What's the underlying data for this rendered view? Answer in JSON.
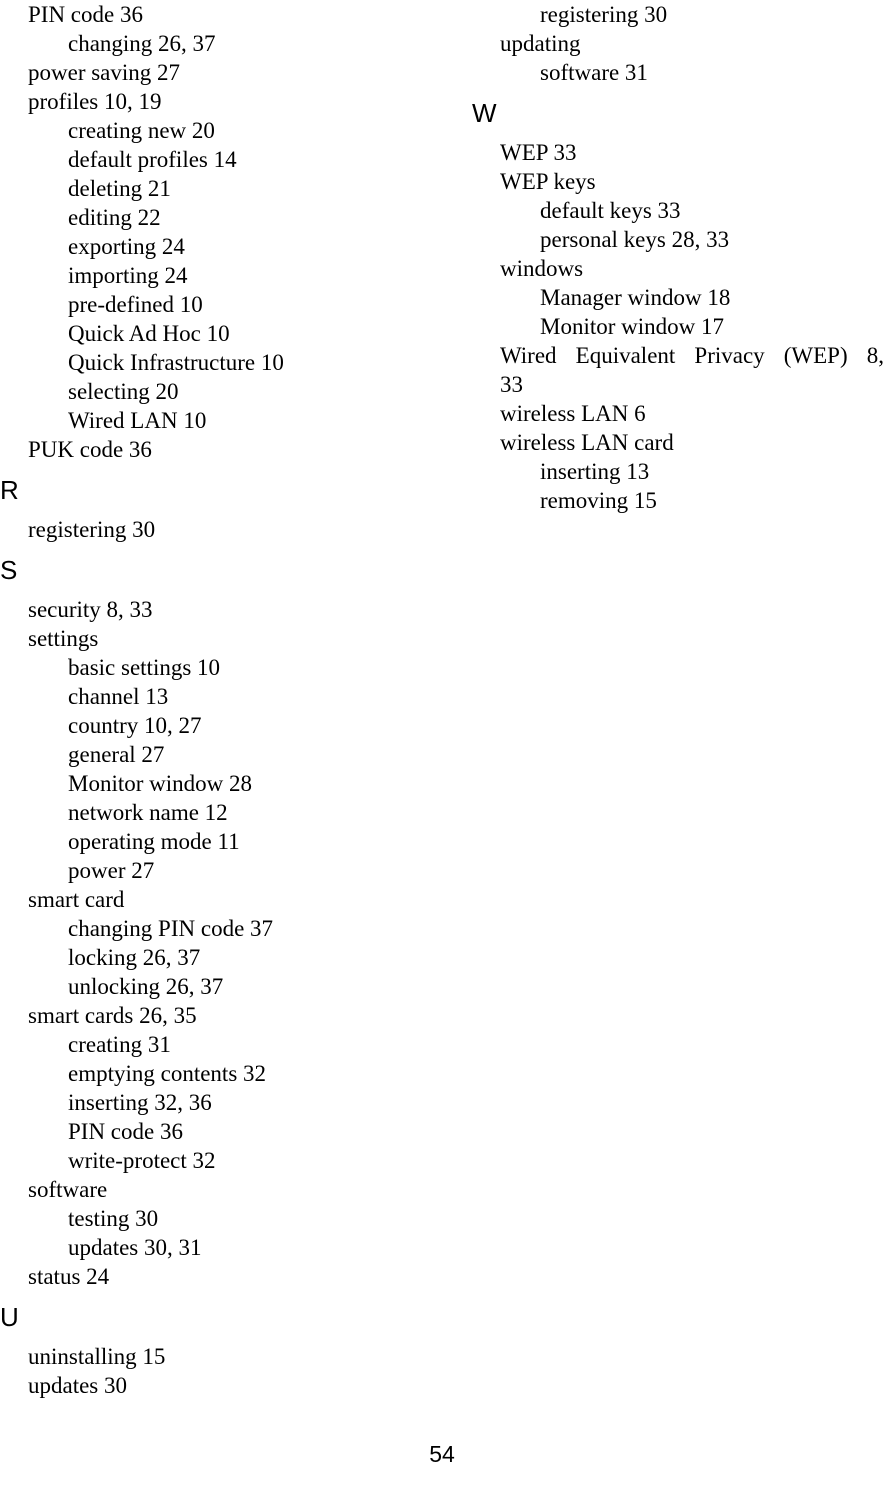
{
  "document": {
    "type": "book-index",
    "folio": "54"
  },
  "left_column": {
    "blocks": [
      {
        "kind": "entries",
        "items": [
          {
            "level": 1,
            "text": "PIN code 36"
          },
          {
            "level": 2,
            "text": "changing 26, 37"
          },
          {
            "level": 1,
            "text": "power saving 27"
          },
          {
            "level": 1,
            "text": "profiles 10, 19"
          },
          {
            "level": 2,
            "text": "creating new 20"
          },
          {
            "level": 2,
            "text": "default profiles 14"
          },
          {
            "level": 2,
            "text": "deleting 21"
          },
          {
            "level": 2,
            "text": "editing 22"
          },
          {
            "level": 2,
            "text": "exporting 24"
          },
          {
            "level": 2,
            "text": "importing 24"
          },
          {
            "level": 2,
            "text": "pre-defined 10"
          },
          {
            "level": 2,
            "text": "Quick Ad Hoc 10"
          },
          {
            "level": 2,
            "text": "Quick Infrastructure 10"
          },
          {
            "level": 2,
            "text": "selecting 20"
          },
          {
            "level": 2,
            "text": "Wired LAN 10"
          },
          {
            "level": 1,
            "text": "PUK code 36"
          }
        ]
      },
      {
        "kind": "letter",
        "letter": "R"
      },
      {
        "kind": "entries",
        "items": [
          {
            "level": 1,
            "text": "registering 30"
          }
        ]
      },
      {
        "kind": "letter",
        "letter": "S"
      },
      {
        "kind": "entries",
        "items": [
          {
            "level": 1,
            "text": "security 8, 33"
          },
          {
            "level": 1,
            "text": "settings"
          },
          {
            "level": 2,
            "text": "basic settings 10"
          },
          {
            "level": 2,
            "text": "channel 13"
          },
          {
            "level": 2,
            "text": "country 10, 27"
          },
          {
            "level": 2,
            "text": "general 27"
          },
          {
            "level": 2,
            "text": "Monitor window 28"
          },
          {
            "level": 2,
            "text": "network name 12"
          },
          {
            "level": 2,
            "text": "operating mode 11"
          },
          {
            "level": 2,
            "text": "power 27"
          },
          {
            "level": 1,
            "text": "smart card"
          },
          {
            "level": 2,
            "text": "changing PIN code 37"
          },
          {
            "level": 2,
            "text": "locking 26, 37"
          },
          {
            "level": 2,
            "text": "unlocking 26, 37"
          },
          {
            "level": 1,
            "text": "smart cards 26, 35"
          },
          {
            "level": 2,
            "text": "creating 31"
          },
          {
            "level": 2,
            "text": "emptying contents 32"
          },
          {
            "level": 2,
            "text": "inserting 32, 36"
          },
          {
            "level": 2,
            "text": "PIN code 36"
          },
          {
            "level": 2,
            "text": "write-protect 32"
          },
          {
            "level": 1,
            "text": "software"
          },
          {
            "level": 2,
            "text": "testing 30"
          },
          {
            "level": 2,
            "text": "updates 30, 31"
          },
          {
            "level": 1,
            "text": "status 24"
          }
        ]
      },
      {
        "kind": "letter",
        "letter": "U"
      },
      {
        "kind": "entries",
        "items": [
          {
            "level": 1,
            "text": "uninstalling 15"
          },
          {
            "level": 1,
            "text": "updates 30"
          }
        ]
      }
    ]
  },
  "right_column": {
    "blocks": [
      {
        "kind": "entries",
        "items": [
          {
            "level": 2,
            "text": "registering 30"
          },
          {
            "level": 1,
            "text": "updating"
          },
          {
            "level": 2,
            "text": "software 31"
          }
        ]
      },
      {
        "kind": "letter",
        "letter": "W"
      },
      {
        "kind": "entries",
        "items": [
          {
            "level": 1,
            "text": "WEP 33"
          },
          {
            "level": 1,
            "text": "WEP keys"
          },
          {
            "level": 2,
            "text": "default keys 33"
          },
          {
            "level": 2,
            "text": "personal keys 28, 33"
          },
          {
            "level": 1,
            "text": "windows"
          },
          {
            "level": 2,
            "text": "Manager window 18"
          },
          {
            "level": 2,
            "text": "Monitor window 17"
          }
        ]
      },
      {
        "kind": "justified",
        "line1": "Wired Equivalent Privacy (WEP) 8,",
        "line2": "33"
      },
      {
        "kind": "entries",
        "items": [
          {
            "level": 1,
            "text": "wireless LAN 6"
          },
          {
            "level": 1,
            "text": "wireless LAN card"
          },
          {
            "level": 2,
            "text": "inserting 13"
          },
          {
            "level": 2,
            "text": "removing 15"
          }
        ]
      }
    ]
  }
}
